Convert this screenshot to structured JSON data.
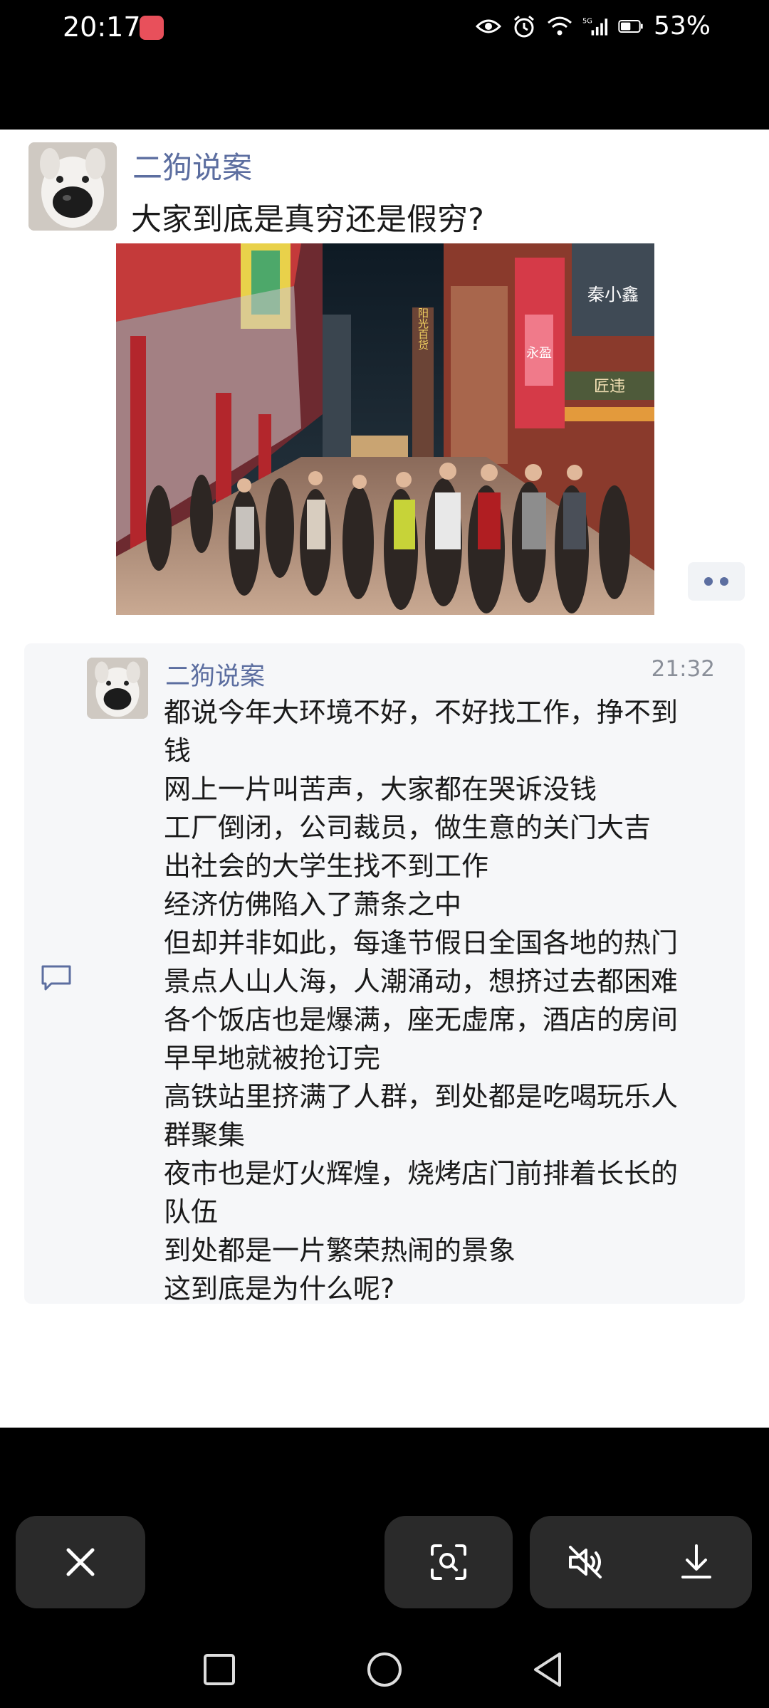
{
  "status_bar": {
    "time": "20:17",
    "battery_percent": "53%",
    "icons": [
      "eye-icon",
      "alarm-icon",
      "wifi-icon",
      "signal-5g-icon",
      "battery-icon"
    ]
  },
  "post": {
    "author": "二狗说案",
    "title": "大家到底是真穷还是假穷?"
  },
  "comment": {
    "author": "二狗说案",
    "time": "21:32",
    "lines": [
      "都说今年大环境不好，不好找工作，挣不到",
      "钱",
      "网上一片叫苦声，大家都在哭诉没钱",
      "工厂倒闭，公司裁员，做生意的关门大吉",
      "出社会的大学生找不到工作",
      "经济仿佛陷入了萧条之中",
      "但却并非如此，每逢节假日全国各地的热门",
      "景点人山人海，人潮涌动，想挤过去都困难",
      "各个饭店也是爆满，座无虚席，酒店的房间",
      "早早地就被抢订完",
      "高铁站里挤满了人群，到处都是吃喝玩乐人",
      "群聚集",
      "夜市也是灯火辉煌，烧烤店门前排着长长的",
      "队伍",
      "到处都是一片繁荣热闹的景象",
      "这到底是为什么呢?"
    ]
  },
  "photo_signs": {
    "s1": "阳光百货",
    "s2": "永盈",
    "s3": "秦小鑫",
    "s4": "匠违"
  },
  "controls": {
    "icons": [
      "close-icon",
      "scan-icon",
      "mute-icon",
      "download-icon"
    ]
  },
  "nav": {
    "icons": [
      "recent-apps-icon",
      "home-icon",
      "back-icon"
    ]
  },
  "colors": {
    "accent": "#5c6ea0",
    "card_bg": "#ffffff",
    "comment_bg": "#f6f7f9",
    "control_bg": "#2a2a2a"
  }
}
